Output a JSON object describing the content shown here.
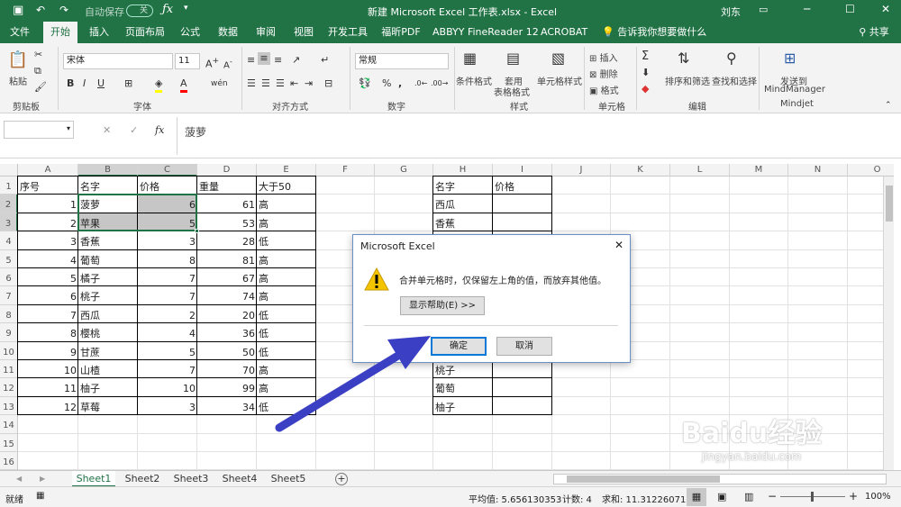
{
  "window": {
    "title": "新建 Microsoft Excel 工作表.xlsx - Excel",
    "user": "刘东",
    "autosave": "自动保存",
    "autosave_state": "关"
  },
  "tabs": [
    "文件",
    "开始",
    "插入",
    "页面布局",
    "公式",
    "数据",
    "审阅",
    "视图",
    "开发工具",
    "福昕PDF",
    "ABBYY FineReader 12",
    "ACROBAT"
  ],
  "tell_me": "告诉我你想要做什么",
  "share": "共享",
  "ribbon": {
    "paste": "粘贴",
    "clipboard": "剪贴板",
    "font_group": "字体",
    "font_name": "宋体",
    "font_size": "11",
    "align_group": "对齐方式",
    "number_group": "数字",
    "number_format": "常规",
    "styles_group": "样式",
    "cond_format": "条件格式",
    "table_format_1": "套用",
    "table_format_2": "表格格式",
    "cell_styles": "单元格样式",
    "cells_group": "单元格",
    "insert": "插入",
    "delete": "删除",
    "format": "格式",
    "edit_group": "编辑",
    "sort_filter": "排序和筛选",
    "find_select": "查找和选择",
    "mindjet_1": "发送到",
    "mindjet_2": "MindManager",
    "mindjet_group": "Mindjet"
  },
  "formula": {
    "fx": "fx",
    "value": "菠萝"
  },
  "columns": [
    "A",
    "B",
    "C",
    "D",
    "E",
    "F",
    "G",
    "H",
    "I",
    "J",
    "K",
    "L",
    "M",
    "N",
    "O"
  ],
  "rows": [
    "1",
    "2",
    "3",
    "4",
    "5",
    "6",
    "7",
    "8",
    "9",
    "10",
    "11",
    "12",
    "13",
    "14",
    "15",
    "16"
  ],
  "table1": {
    "headers": [
      "序号",
      "名字",
      "价格",
      "重量",
      "大于50"
    ],
    "rows": [
      [
        "1",
        "菠萝",
        "6",
        "61",
        "高"
      ],
      [
        "2",
        "苹果",
        "5",
        "53",
        "高"
      ],
      [
        "3",
        "香蕉",
        "3",
        "28",
        "低"
      ],
      [
        "4",
        "葡萄",
        "8",
        "81",
        "高"
      ],
      [
        "5",
        "橘子",
        "7",
        "67",
        "高"
      ],
      [
        "6",
        "桃子",
        "7",
        "74",
        "高"
      ],
      [
        "7",
        "西瓜",
        "2",
        "20",
        "低"
      ],
      [
        "8",
        "樱桃",
        "4",
        "36",
        "低"
      ],
      [
        "9",
        "甘蔗",
        "5",
        "50",
        "低"
      ],
      [
        "10",
        "山楂",
        "7",
        "70",
        "高"
      ],
      [
        "11",
        "柚子",
        "10",
        "99",
        "高"
      ],
      [
        "12",
        "草莓",
        "3",
        "34",
        "低"
      ]
    ]
  },
  "table2": {
    "headers": [
      "名字",
      "价格"
    ],
    "names": [
      "西瓜",
      "香蕉",
      "",
      "",
      "",
      "",
      "",
      "",
      "",
      "桃子",
      "葡萄",
      "柚子"
    ]
  },
  "dialog": {
    "title": "Microsoft Excel",
    "message": "合并单元格时，仅保留左上角的值，而放弃其他值。",
    "help": "显示帮助(E) >>",
    "ok": "确定",
    "cancel": "取消"
  },
  "sheets": [
    "Sheet1",
    "Sheet2",
    "Sheet3",
    "Sheet4",
    "Sheet5"
  ],
  "status": {
    "ready": "就绪",
    "average": "平均值: 5.656130353",
    "count": "计数: 4",
    "sum": "求和: 11.31226071",
    "zoom": "100%"
  },
  "watermark": {
    "brand": "Baidu经验",
    "url": "jingyan.baidu.com"
  },
  "colors": {
    "excel_green": "#217346",
    "arrow": "#3a3fc4"
  }
}
